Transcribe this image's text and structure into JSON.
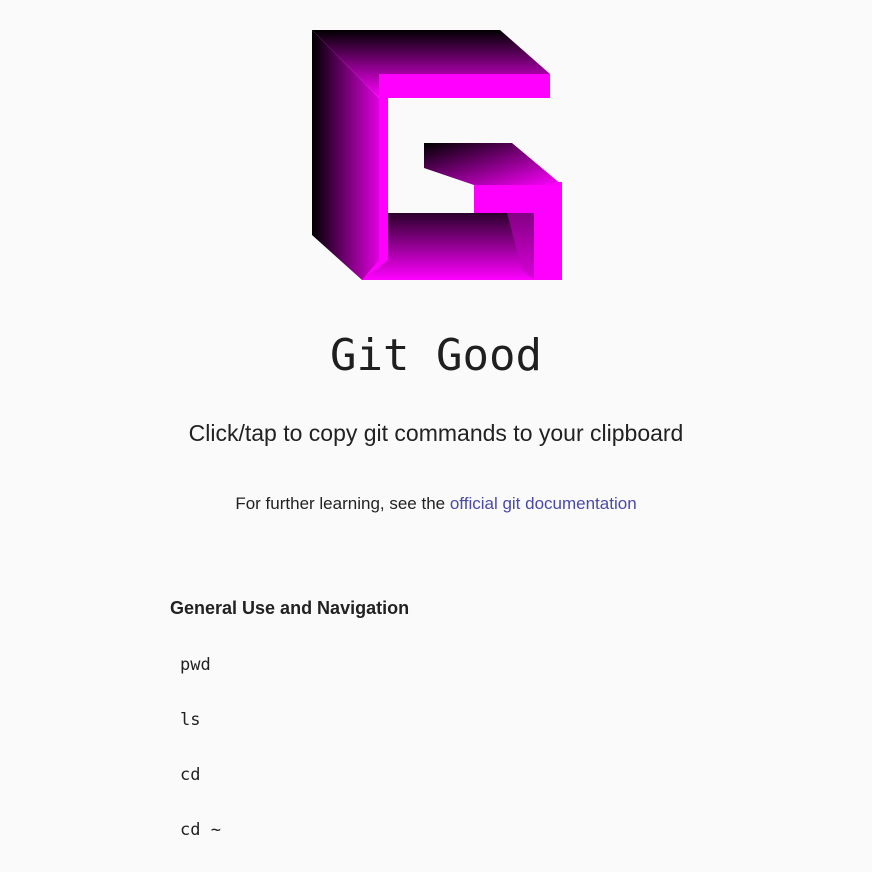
{
  "header": {
    "logo_icon": "git-good-g-logo",
    "logo_colors": {
      "primary": "#ff00ff",
      "shade": "#000000"
    },
    "title": "Git Good",
    "subtitle": "Click/tap to copy git commands to your clipboard",
    "further_prefix": "For further learning, see the ",
    "further_link": "official git documentation"
  },
  "sections": [
    {
      "heading": "General Use and Navigation",
      "commands": [
        "pwd",
        "ls",
        "cd",
        "cd ~"
      ]
    }
  ]
}
